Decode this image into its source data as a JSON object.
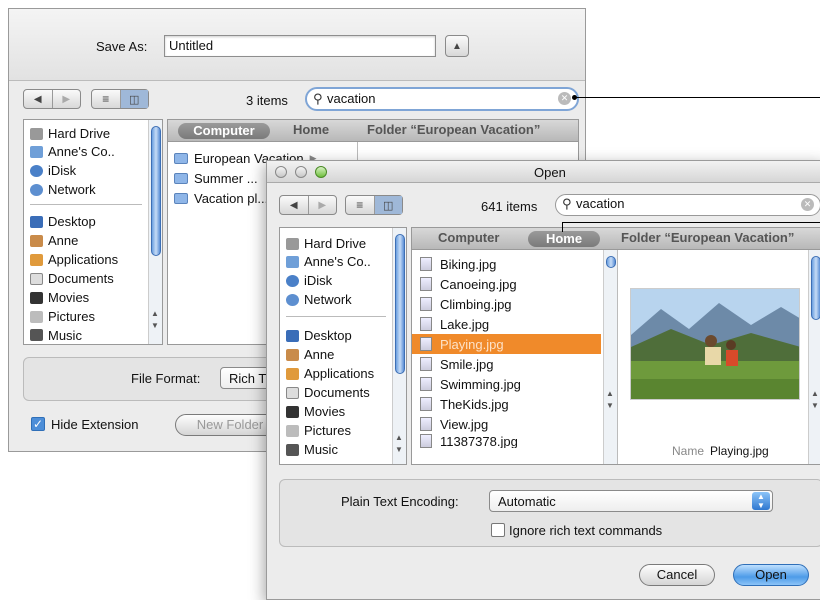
{
  "save_dialog": {
    "save_as_label": "Save As:",
    "save_as_value": "Untitled",
    "item_count": "3 items",
    "search_value": "vacation",
    "sidebar": {
      "devices": [
        "Hard Drive",
        "Anne's Co..",
        "iDisk",
        "Network"
      ],
      "places": [
        "Desktop",
        "Anne",
        "Applications",
        "Documents",
        "Movies",
        "Pictures",
        "Music"
      ]
    },
    "path": {
      "computer": "Computer",
      "home": "Home",
      "folder": "Folder “European Vacation”"
    },
    "results": [
      "European Vacation",
      "Summer ...",
      "Vacation pl..."
    ],
    "file_format_label": "File Format:",
    "file_format_value": "Rich T",
    "hide_extension_label": "Hide Extension",
    "new_folder_label": "New Folder"
  },
  "open_dialog": {
    "title": "Open",
    "item_count": "641 items",
    "search_value": "vacation",
    "sidebar": {
      "devices": [
        "Hard Drive",
        "Anne's Co..",
        "iDisk",
        "Network"
      ],
      "places": [
        "Desktop",
        "Anne",
        "Applications",
        "Documents",
        "Movies",
        "Pictures",
        "Music"
      ]
    },
    "path": {
      "computer": "Computer",
      "home": "Home",
      "folder": "Folder “European Vacation”"
    },
    "files": [
      "Biking.jpg",
      "Canoeing.jpg",
      "Climbing.jpg",
      "Lake.jpg",
      "Playing.jpg",
      "Smile.jpg",
      "Swimming.jpg",
      "TheKids.jpg",
      "View.jpg",
      "11387378.jpg"
    ],
    "selected_file": "Playing.jpg",
    "preview_name_label": "Name",
    "preview_name_value": "Playing.jpg",
    "encoding_label": "Plain Text Encoding:",
    "encoding_value": "Automatic",
    "ignore_rich_label": "Ignore rich text commands",
    "cancel_label": "Cancel",
    "open_label": "Open"
  },
  "icons": {
    "hard_drive": "hard-drive-icon",
    "computer": "computer-icon",
    "idisk": "idisk-icon",
    "network": "network-icon",
    "desktop": "desktop-icon",
    "home": "home-icon",
    "applications": "applications-icon",
    "documents": "documents-icon",
    "movies": "movies-icon",
    "pictures": "pictures-icon",
    "music": "music-icon",
    "search": "search-icon"
  },
  "colors": {
    "selection": "#f08a2a",
    "accent": "#4d9be8",
    "search_ring": "#7fa5d6"
  }
}
